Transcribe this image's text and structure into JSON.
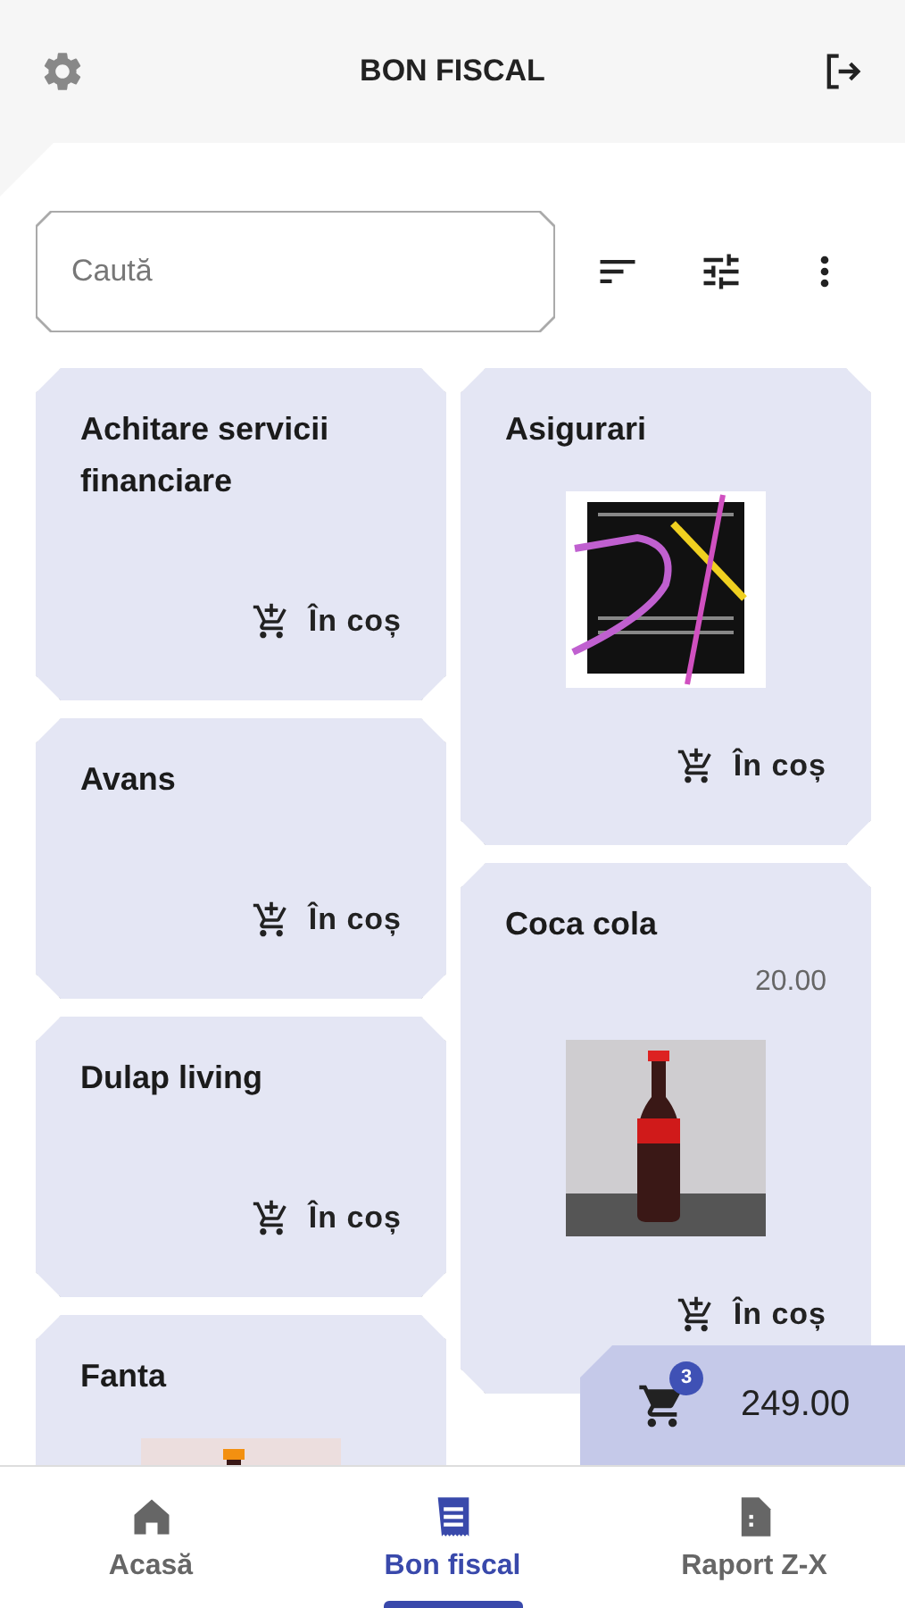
{
  "header": {
    "title": "BON FISCAL"
  },
  "search": {
    "placeholder": "Caută"
  },
  "product_columns": [
    {
      "items": [
        {
          "title": "Achitare servicii financiare",
          "cart_button": "În coș"
        },
        {
          "title": "Avans",
          "cart_button": "În coș"
        },
        {
          "title": "Dulap living",
          "cart_button": "În coș"
        },
        {
          "title": "Fanta"
        }
      ]
    },
    {
      "items": [
        {
          "title": "Asigurari",
          "cart_button": "În coș"
        },
        {
          "title": "Coca cola",
          "price": "20.00",
          "cart_button": "În coș"
        }
      ]
    }
  ],
  "cart": {
    "count": "3",
    "total": "249.00"
  },
  "nav": [
    {
      "label": "Acasă",
      "selected": false
    },
    {
      "label": "Bon fiscal",
      "selected": true
    },
    {
      "label": "Raport Z-X",
      "selected": false
    }
  ]
}
